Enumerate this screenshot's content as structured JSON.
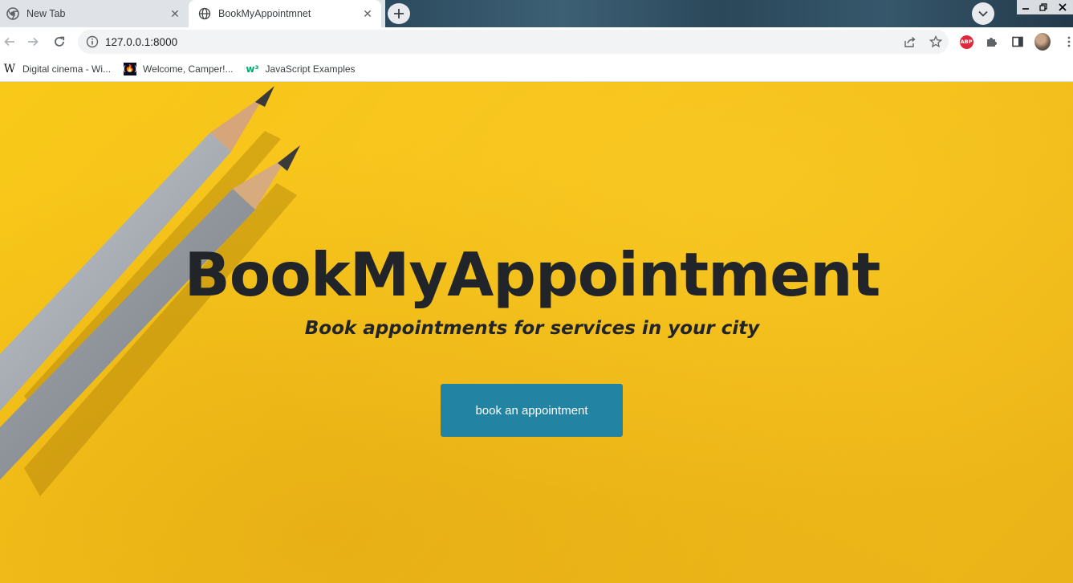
{
  "browser": {
    "tabs": [
      {
        "title": "New Tab",
        "active": false,
        "icon": "chrome-icon"
      },
      {
        "title": "BookMyAppointmnet",
        "active": true,
        "icon": "globe-icon"
      }
    ],
    "address_bar": {
      "url": "127.0.0.1:8000"
    },
    "bookmarks": [
      {
        "label": "Digital cinema - Wi...",
        "icon": "wikipedia-icon"
      },
      {
        "label": "Welcome, Camper!...",
        "icon": "freecodecamp-icon"
      },
      {
        "label": "JavaScript Examples",
        "icon": "w3schools-icon"
      }
    ],
    "extensions": {
      "adblock_label": "ABP"
    }
  },
  "page": {
    "hero": {
      "title": "BookMyAppointment",
      "subtitle": "Book appointments for services in your city",
      "cta_label": "book an appointment"
    },
    "colors": {
      "background": "#f6c21a",
      "text": "#212529",
      "button": "#2283a2",
      "button_text": "#ffffff"
    }
  }
}
